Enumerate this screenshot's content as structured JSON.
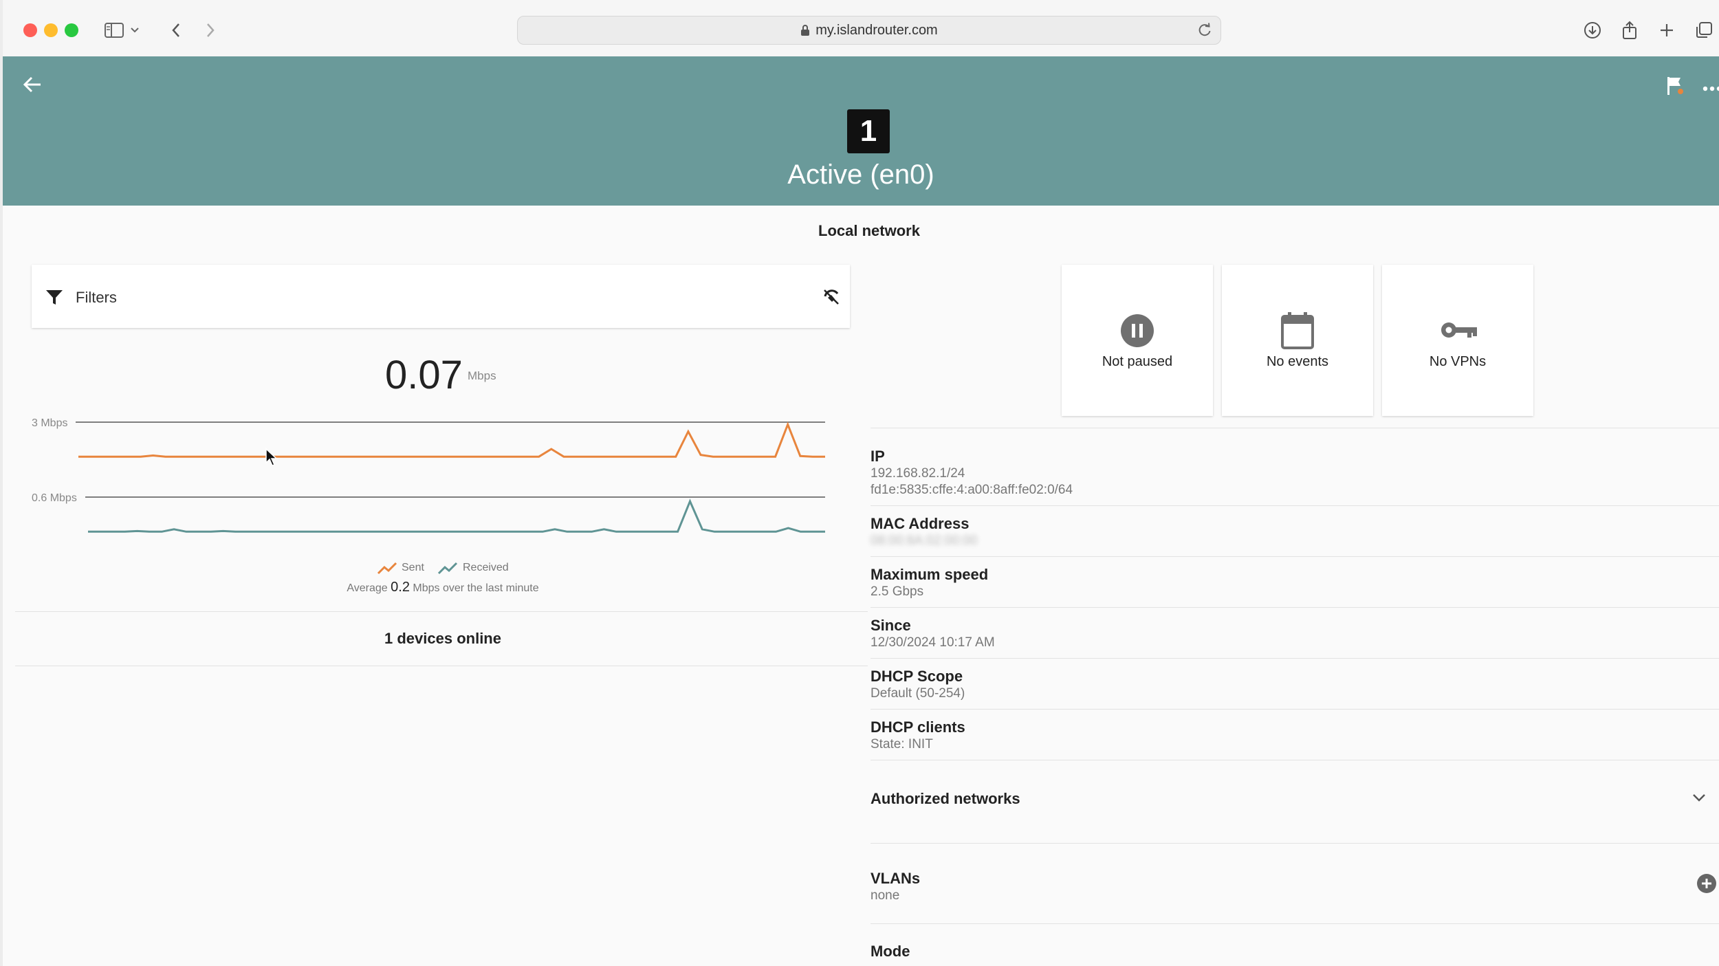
{
  "browser": {
    "url": "my.islandrouter.com",
    "icons": [
      "sidebar-icon",
      "chevron-down-icon",
      "back-icon",
      "forward-icon",
      "lock-icon",
      "reload-icon",
      "download-icon",
      "share-icon",
      "new-tab-icon",
      "tabs-overview-icon"
    ]
  },
  "header": {
    "port_number": "1",
    "status": "Active (en0)",
    "bg_color": "#6a9a9a",
    "icons": [
      "back-arrow-icon",
      "flag-icon",
      "more-icon"
    ]
  },
  "section_title": "Local network",
  "filters": {
    "label": "Filters"
  },
  "throughput": {
    "value": "0.07",
    "unit": "Mbps",
    "average_prefix": "Average",
    "average_value": "0.2",
    "average_suffix": "Mbps over the last minute"
  },
  "chart_data": [
    {
      "type": "line",
      "series": [
        {
          "name": "Sent",
          "color": "#e8853d",
          "values": [
            0.05,
            0.05,
            0.05,
            0.05,
            0.05,
            0.05,
            0.15,
            0.05,
            0.05,
            0.05,
            0.05,
            0.05,
            0.05,
            0.05,
            0.05,
            0.05,
            0.05,
            0.05,
            0.05,
            0.05,
            0.05,
            0.05,
            0.05,
            0.05,
            0.05,
            0.05,
            0.05,
            0.05,
            0.05,
            0.05,
            0.05,
            0.05,
            0.05,
            0.05,
            0.05,
            0.05,
            0.05,
            0.05,
            0.7,
            0.05,
            0.05,
            0.05,
            0.05,
            0.05,
            0.05,
            0.05,
            0.05,
            0.05,
            0.05,
            2.2,
            0.2,
            0.05,
            0.05,
            0.05,
            0.05,
            0.05,
            0.05,
            2.8,
            0.1,
            0.05,
            0.05
          ]
        }
      ],
      "ymax_label": "3 Mbps",
      "ylim": [
        0,
        3
      ]
    },
    {
      "type": "line",
      "series": [
        {
          "name": "Received",
          "color": "#5f9494",
          "values": [
            0.02,
            0.02,
            0.02,
            0.02,
            0.03,
            0.02,
            0.02,
            0.06,
            0.02,
            0.02,
            0.02,
            0.03,
            0.02,
            0.02,
            0.02,
            0.02,
            0.02,
            0.02,
            0.02,
            0.02,
            0.02,
            0.02,
            0.02,
            0.02,
            0.02,
            0.02,
            0.02,
            0.02,
            0.02,
            0.02,
            0.02,
            0.02,
            0.02,
            0.02,
            0.02,
            0.02,
            0.02,
            0.02,
            0.06,
            0.02,
            0.02,
            0.02,
            0.06,
            0.02,
            0.02,
            0.02,
            0.02,
            0.02,
            0.02,
            0.53,
            0.06,
            0.02,
            0.02,
            0.02,
            0.02,
            0.02,
            0.02,
            0.08,
            0.02,
            0.02,
            0.02
          ]
        }
      ],
      "ymax_label": "0.6 Mbps",
      "ylim": [
        0,
        0.6
      ]
    }
  ],
  "legend": {
    "sent": "Sent",
    "received": "Received"
  },
  "devices_online": "1 devices online",
  "tiles": [
    {
      "label": "Not paused",
      "icon": "pause-circle-icon"
    },
    {
      "label": "No events",
      "icon": "calendar-icon"
    },
    {
      "label": "No VPNs",
      "icon": "key-icon"
    }
  ],
  "info": {
    "ip_label": "IP",
    "ip_v4": "192.168.82.1/24",
    "ip_v6": "fd1e:5835:cffe:4:a00:8aff:fe02:0/64",
    "mac_label": "MAC Address",
    "mac_value": "08:00:8A:02:00:00",
    "speed_label": "Maximum speed",
    "speed_value": "2.5 Gbps",
    "since_label": "Since",
    "since_value": "12/30/2024 10:17 AM",
    "dhcp_scope_label": "DHCP Scope",
    "dhcp_scope_value": "Default (50-254)",
    "dhcp_clients_label": "DHCP clients",
    "dhcp_clients_value": "State: INIT",
    "authorized_label": "Authorized networks",
    "vlans_label": "VLANs",
    "vlans_value": "none",
    "mode_label": "Mode"
  }
}
